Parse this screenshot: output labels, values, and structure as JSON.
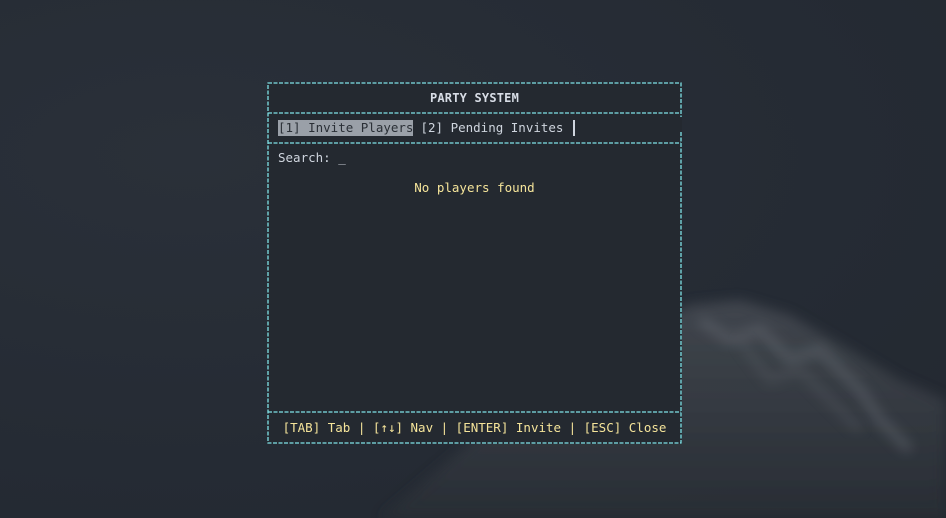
{
  "window": {
    "title": "PARTY SYSTEM"
  },
  "tabs": [
    {
      "label": "[1] Invite Players",
      "active": true
    },
    {
      "label": "[2] Pending Invites",
      "active": false
    }
  ],
  "search": {
    "label": "Search: ",
    "value": "_"
  },
  "results": {
    "empty_message": "No players found"
  },
  "footer": {
    "hints": "[TAB] Tab | [↑↓] Nav | [ENTER] Invite | [ESC] Close"
  },
  "colors": {
    "border": "#7fe3e8",
    "accent_text": "#f5e49a",
    "active_tab_bg": "#9aa0a8"
  }
}
